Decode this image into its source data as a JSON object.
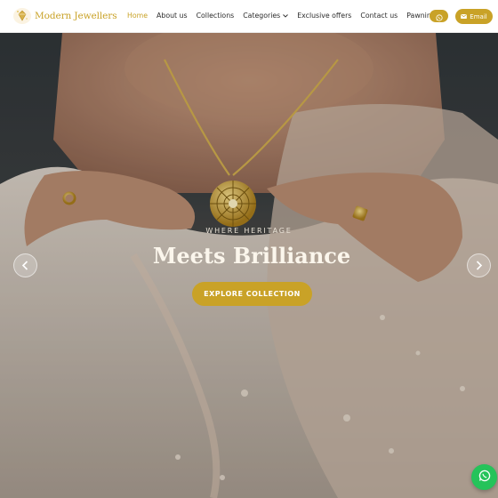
{
  "brand": {
    "name": "Modern Jewellers",
    "logo_icon": "diamond-logo-icon"
  },
  "nav": {
    "items": [
      {
        "label": "Home",
        "active": true
      },
      {
        "label": "About us"
      },
      {
        "label": "Collections"
      },
      {
        "label": "Categories",
        "dropdown": true
      },
      {
        "label": "Exclusive offers"
      },
      {
        "label": "Contact us"
      },
      {
        "label": "Pawning"
      }
    ],
    "whatsapp_icon": "whatsapp-icon",
    "email_label": "Email",
    "email_icon": "envelope-icon"
  },
  "hero": {
    "kicker": "WHERE HERITAGE",
    "title": "Meets Brilliance",
    "cta_label": "EXPLORE COLLECTION",
    "prev_icon": "chevron-left-icon",
    "next_icon": "chevron-right-icon"
  },
  "floating": {
    "whatsapp_icon": "whatsapp-icon"
  },
  "colors": {
    "accent": "#c9a227",
    "whatsapp": "#25c35a",
    "header_bg": "#ffffff"
  }
}
